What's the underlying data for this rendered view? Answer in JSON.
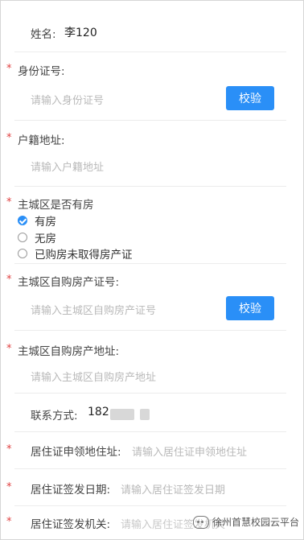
{
  "form": {
    "name_label": "姓名:",
    "name_value": "李120",
    "id_label": "身份证号:",
    "id_placeholder": "请输入身份证号",
    "verify_label": "校验",
    "household_label": "户籍地址:",
    "household_placeholder": "请输入户籍地址",
    "house_question_label": "主城区是否有房",
    "house_options": [
      "有房",
      "无房",
      "已购房未取得房产证"
    ],
    "house_selected": "有房",
    "cert_no_label": "主城区自购房产证号:",
    "cert_no_placeholder": "请输入主城区自购房产证号",
    "cert_addr_label": "主城区自购房产地址:",
    "cert_addr_placeholder": "请输入主城区自购房产地址",
    "contact_label": "联系方式:",
    "contact_value": "182",
    "permit_addr_label": "居住证申领地住址:",
    "permit_addr_placeholder": "请输入居住证申领地住址",
    "permit_date_label": "居住证签发日期:",
    "permit_date_placeholder": "请输入居住证签发日期",
    "permit_org_label": "居住证签发机关:",
    "permit_org_placeholder": "请输入居住证签发机关",
    "required_mark": "*"
  },
  "watermark": {
    "text": "徐州首慧校园云平台",
    "icon": "wechat-icon"
  },
  "colors": {
    "accent": "#2a8ff7",
    "required": "#e04040",
    "placeholder": "#b9b9b9"
  }
}
